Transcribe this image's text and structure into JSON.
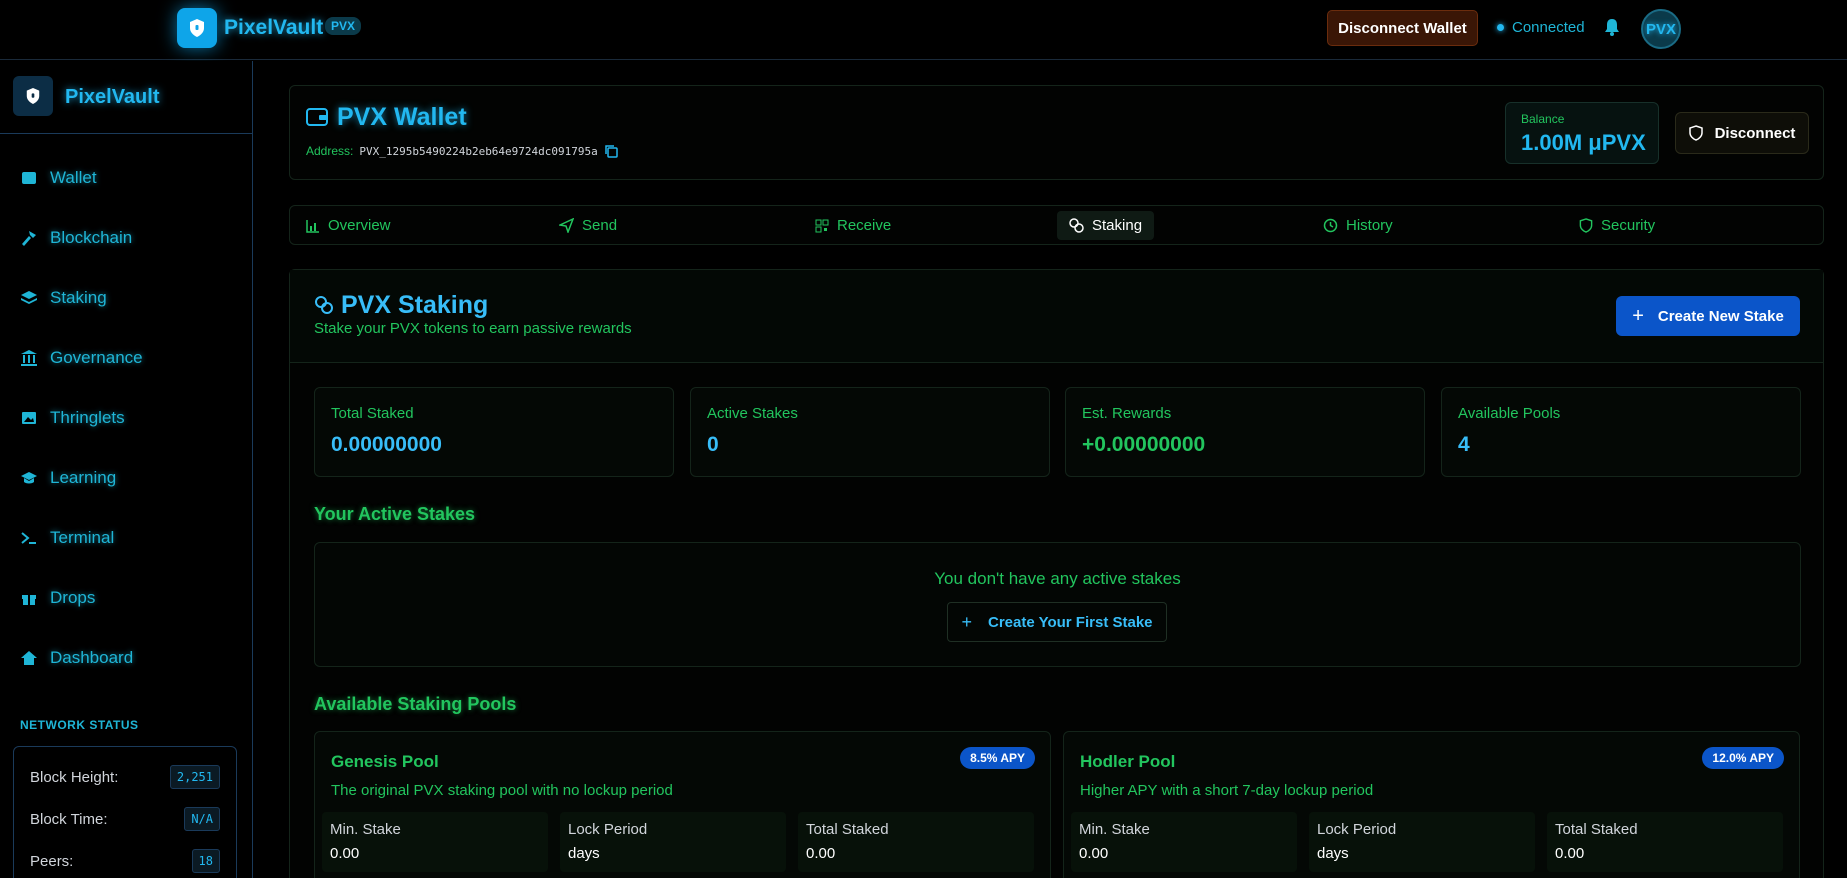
{
  "topbar": {
    "app_name": "PixelVault",
    "token_badge": "PVX",
    "disconnect_wallet": "Disconnect  Wallet",
    "status": "Connected",
    "avatar": "PVX"
  },
  "sidebar": {
    "brand": "PixelVault",
    "items": [
      {
        "label": "Wallet",
        "icon": "wallet-icon"
      },
      {
        "label": "Blockchain",
        "icon": "hammer-icon"
      },
      {
        "label": "Staking",
        "icon": "layers-icon"
      },
      {
        "label": "Governance",
        "icon": "landmark-icon"
      },
      {
        "label": "Thringlets",
        "icon": "image-icon"
      },
      {
        "label": "Learning",
        "icon": "graduation-cap-icon"
      },
      {
        "label": "Terminal",
        "icon": "terminal-icon"
      },
      {
        "label": "Drops",
        "icon": "gift-icon"
      },
      {
        "label": "Dashboard",
        "icon": "home-icon"
      }
    ],
    "network_status": {
      "title": "NETWORK STATUS",
      "rows": [
        {
          "label": "Block Height:",
          "value": "2,251"
        },
        {
          "label": "Block Time:",
          "value": "N/A"
        },
        {
          "label": "Peers:",
          "value": "18"
        }
      ]
    }
  },
  "wallet": {
    "title": "PVX Wallet",
    "address_label": "Address:",
    "address": "PVX_1295b5490224b2eb64e9724dc091795a",
    "balance_label": "Balance",
    "balance": "1.00M μPVX",
    "disconnect": "Disconnect"
  },
  "tabs": [
    {
      "label": "Overview",
      "icon": "bar-chart-icon",
      "active": false
    },
    {
      "label": "Send",
      "icon": "send-icon",
      "active": false
    },
    {
      "label": "Receive",
      "icon": "qr-code-icon",
      "active": false
    },
    {
      "label": "Staking",
      "icon": "coins-icon",
      "active": true
    },
    {
      "label": "History",
      "icon": "history-icon",
      "active": false
    },
    {
      "label": "Security",
      "icon": "shield-icon",
      "active": false
    }
  ],
  "staking": {
    "title": "PVX Staking",
    "subtitle": "Stake your PVX tokens to earn passive rewards",
    "create_button": "Create New Stake",
    "stats": [
      {
        "label": "Total Staked",
        "value": "0.00000000"
      },
      {
        "label": "Active Stakes",
        "value": "0"
      },
      {
        "label": "Est. Rewards",
        "value": "+0.00000000"
      },
      {
        "label": "Available Pools",
        "value": "4"
      }
    ],
    "active_title": "Your Active Stakes",
    "empty_message": "You don't have any active stakes",
    "first_stake_button": "Create Your First Stake",
    "pools_title": "Available Staking Pools",
    "pools": [
      {
        "name": "Genesis Pool",
        "apy": "8.5% APY",
        "description": "The original PVX staking pool with no lockup period",
        "min_stake_label": "Min. Stake",
        "min_stake": "0.00",
        "lock_label": "Lock Period",
        "lock": "days",
        "total_label": "Total Staked",
        "total": "0.00"
      },
      {
        "name": "Hodler Pool",
        "apy": "12.0% APY",
        "description": "Higher APY with a short 7-day lockup period",
        "min_stake_label": "Min. Stake",
        "min_stake": "0.00",
        "lock_label": "Lock Period",
        "lock": "days",
        "total_label": "Total Staked",
        "total": "0.00"
      }
    ]
  },
  "colors": {
    "accent_cyan": "#22b8f0",
    "accent_green": "#22c55e",
    "primary_blue": "#0b55c9",
    "danger_brown": "#3a1606"
  }
}
